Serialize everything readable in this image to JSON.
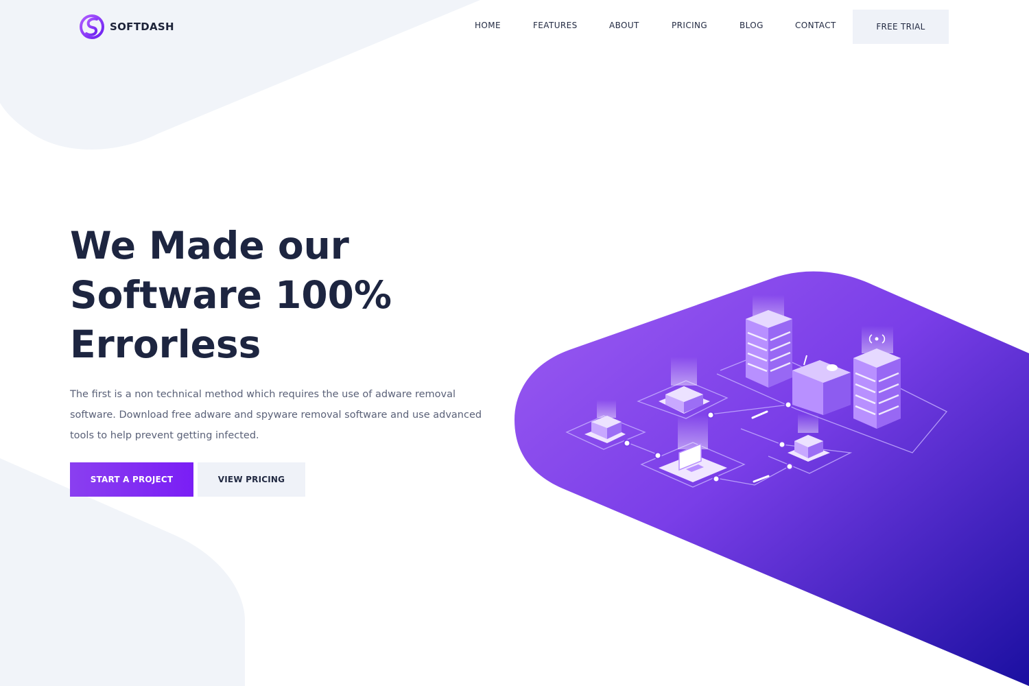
{
  "brand": {
    "name": "SOFTDASH",
    "logo_icon": "softdash-s-icon",
    "accent": "#8a3ff0"
  },
  "nav": {
    "items": [
      {
        "label": "HOME"
      },
      {
        "label": "FEATURES"
      },
      {
        "label": "ABOUT"
      },
      {
        "label": "PRICING"
      },
      {
        "label": "BLOG"
      },
      {
        "label": "CONTACT"
      }
    ],
    "cta_label": "FREE TRIAL"
  },
  "hero": {
    "title_lines": [
      "We Made our",
      "Software 100%",
      "Errorless"
    ],
    "description": "The first is a non technical method which requires the use of adware removal software. Download free adware and spyware removal software and use advanced tools to help prevent getting infected.",
    "primary_button": "START A PROJECT",
    "secondary_button": "VIEW PRICING"
  },
  "colors": {
    "heading": "#1d2540",
    "body_text": "#5a6178",
    "light_bg": "#eff2f8",
    "gradient_start": "#9b5cf0",
    "gradient_end": "#1a0fa0"
  },
  "illustration": {
    "icon": "isometric-server-network-illustration"
  }
}
